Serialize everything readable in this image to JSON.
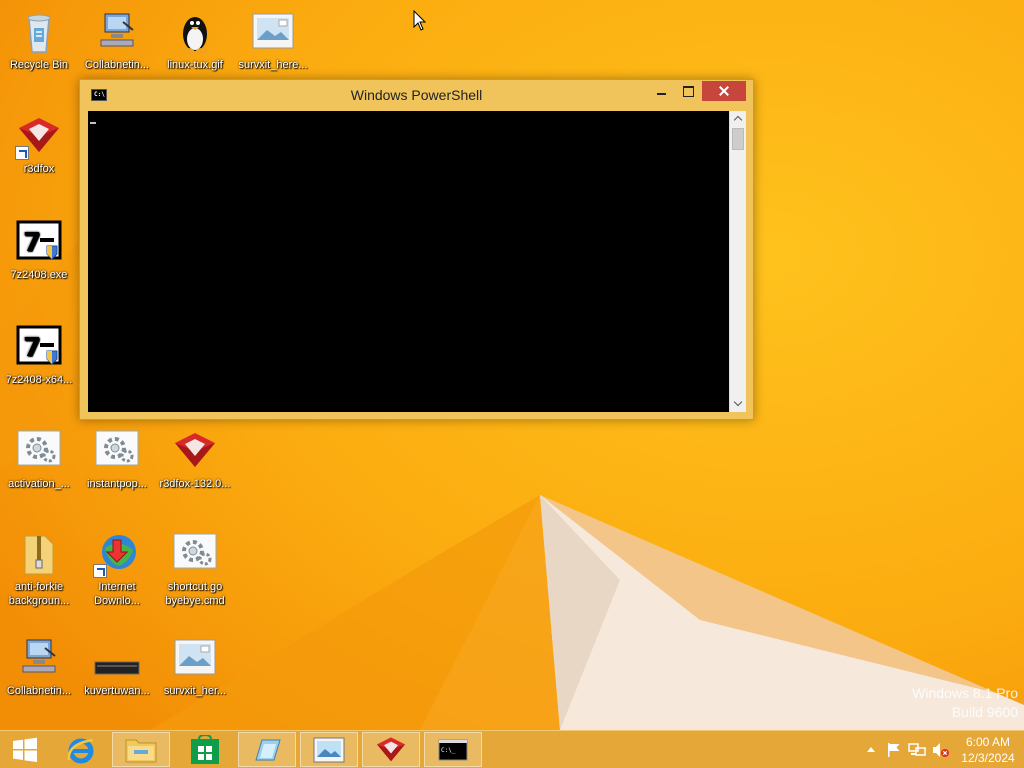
{
  "desktop": {
    "icons": [
      {
        "id": "recycle-bin",
        "label": "Recycle Bin",
        "icon": "recycle-bin-icon"
      },
      {
        "id": "collabnet-1",
        "label": "Collabnetin...",
        "icon": "network-computer-icon"
      },
      {
        "id": "linux-tux",
        "label": "linux-tux.gif",
        "icon": "tux-penguin-icon"
      },
      {
        "id": "survxit-1",
        "label": "survxit_here...",
        "icon": "image-file-icon"
      },
      {
        "id": "r3dfox",
        "label": "r3dfox",
        "icon": "r3dfox-browser-icon"
      },
      {
        "id": "7z2408",
        "label": "7z2408.exe",
        "icon": "7zip-installer-icon"
      },
      {
        "id": "7z2408-x64",
        "label": "7z2408-x64...",
        "icon": "7zip-installer-icon"
      },
      {
        "id": "activation",
        "label": "activation_...",
        "icon": "settings-file-icon"
      },
      {
        "id": "instantpop",
        "label": "instantpop...",
        "icon": "settings-file-icon"
      },
      {
        "id": "r3dfox-132",
        "label": "r3dfox-132.0...",
        "icon": "r3dfox-browser-icon"
      },
      {
        "id": "anti-forkie",
        "label": "anti-forkie\nbackgroun...",
        "icon": "zip-folder-icon"
      },
      {
        "id": "idm",
        "label": "Internet\nDownlo...",
        "icon": "internet-download-manager-icon"
      },
      {
        "id": "shortcut-go",
        "label": "shortcut.go\nbyebye.cmd",
        "icon": "settings-file-icon"
      },
      {
        "id": "collabnet-2",
        "label": "Collabnetin...",
        "icon": "network-computer-icon"
      },
      {
        "id": "kuvertuwan",
        "label": "kuvertuwan...",
        "icon": "dark-bar-file-icon"
      },
      {
        "id": "survxit-2",
        "label": "survxit_her...",
        "icon": "image-file-icon"
      }
    ]
  },
  "window": {
    "title": "Windows PowerShell",
    "app_icon_text": "C:\\",
    "console_bg": "#000000"
  },
  "watermark": {
    "line1": "Windows 8.1 Pro",
    "line2": "Build 9600"
  },
  "taskbar": {
    "apps": [
      {
        "name": "start-button",
        "icon": "windows-logo-icon"
      },
      {
        "name": "internet-explorer",
        "icon": "internet-explorer-icon"
      },
      {
        "name": "file-explorer",
        "icon": "file-explorer-icon",
        "active": true
      },
      {
        "name": "store",
        "icon": "store-icon"
      },
      {
        "name": "app-4",
        "icon": "notepad-icon",
        "active": true
      },
      {
        "name": "app-5",
        "icon": "image-viewer-icon",
        "active": true
      },
      {
        "name": "r3dfox",
        "icon": "r3dfox-browser-icon",
        "active": true
      },
      {
        "name": "powershell",
        "icon": "console-icon",
        "active": true
      }
    ],
    "clock": {
      "time": "6:00 AM",
      "date": "12/3/2024"
    },
    "tray": [
      "show-hidden-icons",
      "action-center-flag",
      "network",
      "volume-muted"
    ]
  },
  "colors": {
    "wallpaper": "#f9a90c",
    "window_frame": "#f0c45a",
    "close_button": "#c7463c",
    "taskbar": "#e4a738"
  }
}
